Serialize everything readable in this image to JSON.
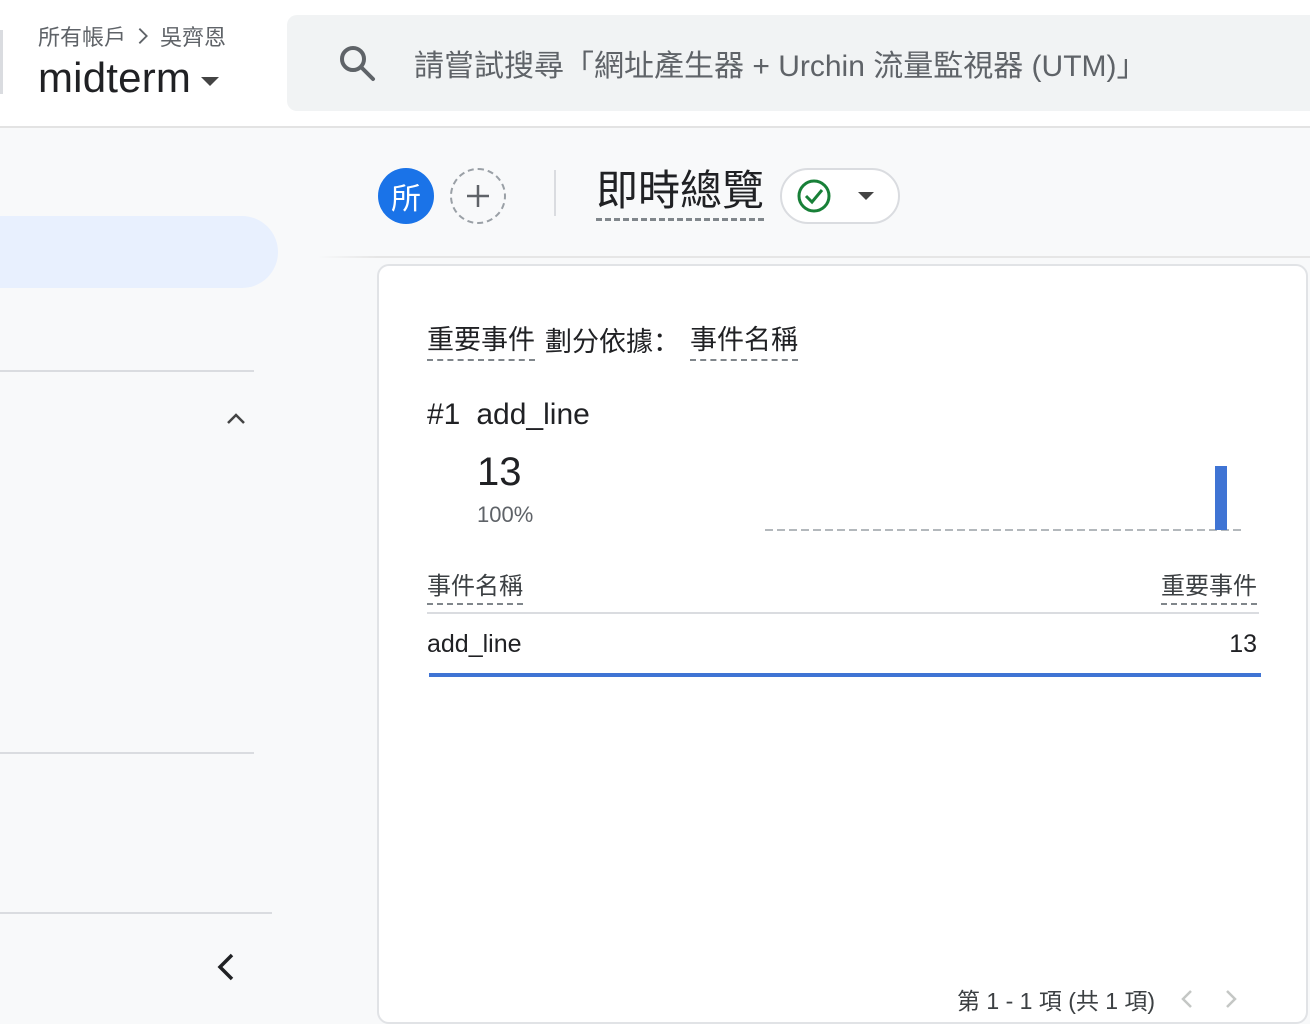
{
  "header": {
    "breadcrumb_root": "所有帳戶",
    "breadcrumb_account": "吳齊恩",
    "property_name": "midterm",
    "search_placeholder": "請嘗試搜尋「網址產生器 + Urchin 流量監視器 (UTM)」"
  },
  "toolbar": {
    "avatar_letter": "所",
    "page_title": "即時總覽",
    "status": "ok"
  },
  "card": {
    "title_metric": "重要事件",
    "title_middle": "劃分依據：",
    "title_dimension": "事件名稱",
    "top_rank": "#1",
    "top_name": "add_line",
    "top_value": "13",
    "top_percent": "100%",
    "table": {
      "headers": [
        "事件名稱",
        "重要事件"
      ],
      "rows": [
        {
          "name": "add_line",
          "value": "13",
          "share": 1.0
        }
      ]
    },
    "pager_text": "第 1 - 1 項 (共 1 項)"
  },
  "chart_data": {
    "type": "bar",
    "minutes": 30,
    "values": [
      0,
      0,
      0,
      0,
      0,
      0,
      0,
      0,
      0,
      0,
      0,
      0,
      0,
      0,
      0,
      0,
      0,
      0,
      0,
      0,
      0,
      0,
      0,
      0,
      0,
      0,
      0,
      0,
      13,
      0
    ],
    "bar_color": "#3f74d4"
  }
}
